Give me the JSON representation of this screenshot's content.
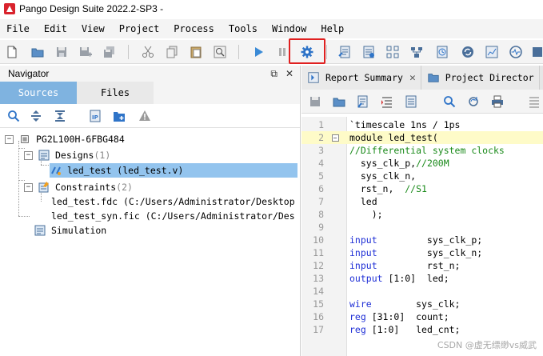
{
  "window": {
    "title": "Pango Design Suite 2022.2-SP3 - "
  },
  "menu": [
    "File",
    "Edit",
    "View",
    "Project",
    "Process",
    "Tools",
    "Window",
    "Help"
  ],
  "toolbar": {
    "highlighted": "settings-gear",
    "icons": [
      "new-file",
      "open-folder",
      "save",
      "save-as",
      "save-all",
      "cut",
      "copy",
      "find",
      "run",
      "pause",
      "settings-gear",
      "report",
      "properties",
      "schematic",
      "netlist",
      "timing",
      "sync",
      "analyze",
      "pulse"
    ]
  },
  "navigator": {
    "title": "Navigator",
    "header_icons": [
      "⧉",
      "✕"
    ],
    "tabs": [
      {
        "label": "Sources",
        "active": true
      },
      {
        "label": "Files",
        "active": false
      }
    ],
    "tree": {
      "device": "PG2L100H-6FBG484",
      "designs_label": "Designs",
      "designs_count": "(1)",
      "design_item": "led_test (led_test.v)",
      "constraints_label": "Constraints",
      "constraints_count": "(2)",
      "constraint_files": [
        "led_test.fdc (C:/Users/Administrator/Desktop",
        "led_test_syn.fic (C:/Users/Administrator/Des"
      ],
      "simulation_label": "Simulation"
    }
  },
  "editor": {
    "tabs": [
      {
        "label": "Report Summary",
        "closable": true
      },
      {
        "label": "Project Director",
        "closable": false
      }
    ],
    "current_line": 2,
    "lines": [
      {
        "n": "1",
        "segments": [
          {
            "t": "`timescale 1ns / 1ps",
            "c": "plain"
          }
        ]
      },
      {
        "n": "2",
        "fold": true,
        "segments": [
          {
            "t": "module led_test(",
            "c": "plain"
          }
        ]
      },
      {
        "n": "3",
        "segments": [
          {
            "t": "//Differential system clocks",
            "c": "cm"
          }
        ]
      },
      {
        "n": "4",
        "segments": [
          {
            "t": "  sys_clk_p,",
            "c": "plain"
          },
          {
            "t": "//200M",
            "c": "cm"
          }
        ]
      },
      {
        "n": "5",
        "segments": [
          {
            "t": "  sys_clk_n,",
            "c": "plain"
          }
        ]
      },
      {
        "n": "6",
        "segments": [
          {
            "t": "  rst_n,  ",
            "c": "plain"
          },
          {
            "t": "//S1",
            "c": "cm"
          }
        ]
      },
      {
        "n": "7",
        "segments": [
          {
            "t": "  led",
            "c": "plain"
          }
        ]
      },
      {
        "n": "8",
        "segments": [
          {
            "t": "    );",
            "c": "plain"
          }
        ]
      },
      {
        "n": "9",
        "segments": []
      },
      {
        "n": "10",
        "segments": [
          {
            "t": "input",
            "c": "kw"
          },
          {
            "t": "         sys_clk_p;",
            "c": "plain"
          }
        ]
      },
      {
        "n": "11",
        "segments": [
          {
            "t": "input",
            "c": "kw"
          },
          {
            "t": "         sys_clk_n;",
            "c": "plain"
          }
        ]
      },
      {
        "n": "12",
        "segments": [
          {
            "t": "input",
            "c": "kw"
          },
          {
            "t": "         rst_n;",
            "c": "plain"
          }
        ]
      },
      {
        "n": "13",
        "segments": [
          {
            "t": "output",
            "c": "kw"
          },
          {
            "t": " [1:0]  led;",
            "c": "plain"
          }
        ]
      },
      {
        "n": "14",
        "segments": []
      },
      {
        "n": "15",
        "segments": [
          {
            "t": "wire",
            "c": "kw"
          },
          {
            "t": "        sys_clk;",
            "c": "plain"
          }
        ]
      },
      {
        "n": "16",
        "segments": [
          {
            "t": "reg",
            "c": "kw"
          },
          {
            "t": " [31:0]  count;",
            "c": "plain"
          }
        ]
      },
      {
        "n": "17",
        "segments": [
          {
            "t": "reg",
            "c": "kw"
          },
          {
            "t": " [1:0]   led_cnt;",
            "c": "plain"
          }
        ]
      }
    ]
  },
  "watermark": "CSDN @虚无缥缈vs威武"
}
